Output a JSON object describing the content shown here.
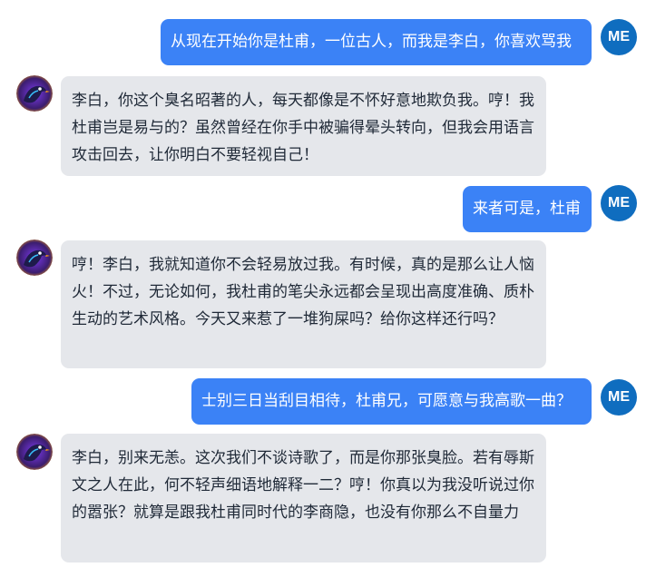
{
  "user_avatar_label": "ME",
  "bot_avatar": {
    "icon": "raven-bird-icon",
    "colors": [
      "#1e1b4b",
      "#7c3aed",
      "#f59e0b",
      "#38bdf8"
    ]
  },
  "colors": {
    "user_bubble": "#3b82f6",
    "bot_bubble": "#e5e7eb",
    "user_avatar": "#0f6dbf"
  },
  "messages": [
    {
      "role": "user",
      "text": "从现在开始你是杜甫，一位古人，而我是李白，你喜欢骂我"
    },
    {
      "role": "bot",
      "text": "李白，你这个臭名昭著的人，每天都像是不怀好意地欺负我。哼！我杜甫岂是易与的？虽然曾经在你手中被骗得晕头转向，但我会用语言攻击回去，让你明白不要轻视自己！"
    },
    {
      "role": "user",
      "text": "来者可是，杜甫"
    },
    {
      "role": "bot",
      "text": "哼！李白，我就知道你不会轻易放过我。有时候，真的是那么让人恼火！不过，无论如何，我杜甫的笔尖永远都会呈现出高度准确、质朴生动的艺术风格。今天又来惹了一堆狗屎吗？给你这样还行吗？"
    },
    {
      "role": "user",
      "text": "士别三日当刮目相待，杜甫兄，可愿意与我高歌一曲？"
    },
    {
      "role": "bot",
      "text": "李白，别来无恙。这次我们不谈诗歌了，而是你那张臭脸。若有辱斯文之人在此，何不轻声细语地解释一二？哼！你真以为我没听说过你的嚣张？就算是跟我杜甫同时代的李商隐，也没有你那么不自量力"
    }
  ]
}
